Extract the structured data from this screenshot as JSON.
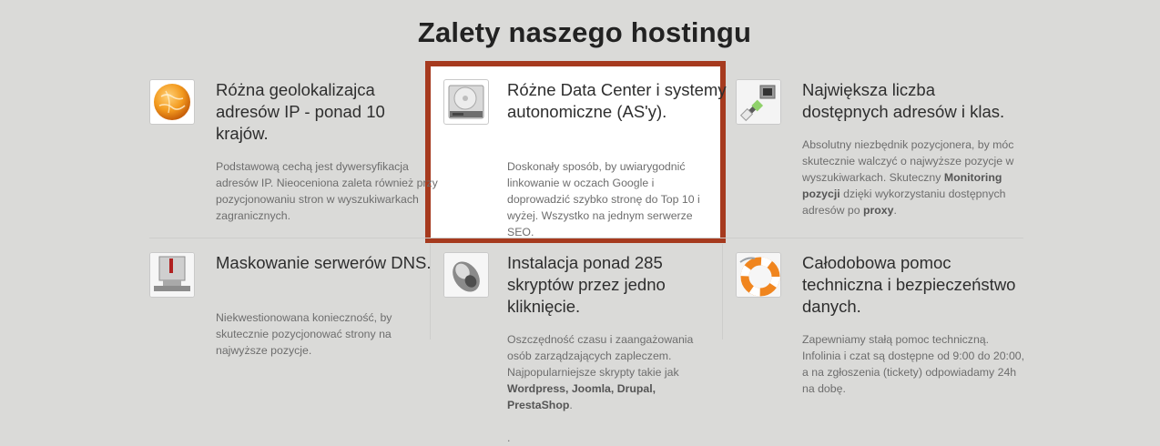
{
  "page": {
    "title": "Zalety naszego hostingu"
  },
  "features": [
    {
      "title": "Różna geolokalizajca adresów IP - ponad 10 krajów.",
      "description": "Podstawową cechą jest dywersyfikacja adresów IP. Nieoceniona zaleta również przy pozycjonowaniu stron w wyszukiwarkach zagranicznych.",
      "icon": "globe-icon"
    },
    {
      "title": "Różne Data Center i systemy autonomiczne (AS'y).",
      "description": "Doskonały sposób, by uwiarygodnić linkowanie w oczach Google i doprowadzić szybko stronę do Top 10 i wyżej. Wszystko na jednym serwerze SEO.",
      "icon": "hard-drive-icon",
      "highlight_color": "#a63a1e"
    },
    {
      "title": "Największa liczba dostępnych adresów i klas.",
      "description_parts": {
        "p1": "Absolutny niezbędnik pozycjonera, by móc skutecznie walczyć o najwyższe pozycje w wyszukiwarkach. Skuteczny ",
        "b1": "Monitoring pozycji",
        "p2": " dzięki wykorzystaniu dostępnych adresów po ",
        "b2": "proxy",
        "p3": "."
      },
      "icon": "network-cable-icon"
    },
    {
      "title": "Maskowanie serwerów DNS.",
      "description": "Niekwestionowana konieczność, by skutecznie pozycjonować strony na najwyższe pozycje.",
      "icon": "server-icon"
    },
    {
      "title": "Instalacja ponad 285 skryptów przez jedno kliknięcie.",
      "description_parts": {
        "p1": "Oszczędność czasu i zaangażowania osób zarządzających zapleczem. Najpopularniejsze skrypty takie jak ",
        "b1": "Wordpress, Joomla, Drupal, PrestaShop",
        "p2": ".",
        "trailing": "."
      },
      "icon": "mouse-icon"
    },
    {
      "title": "Całodobowa pomoc techniczna i bezpieczeństwo danych.",
      "description": "Zapewniamy stałą pomoc techniczną. Infolinia i czat są dostępne od 9:00 do 20:00, a na zgłoszenia (tickety) odpowiadamy 24h na dobę.",
      "icon": "lifebuoy-icon"
    }
  ]
}
